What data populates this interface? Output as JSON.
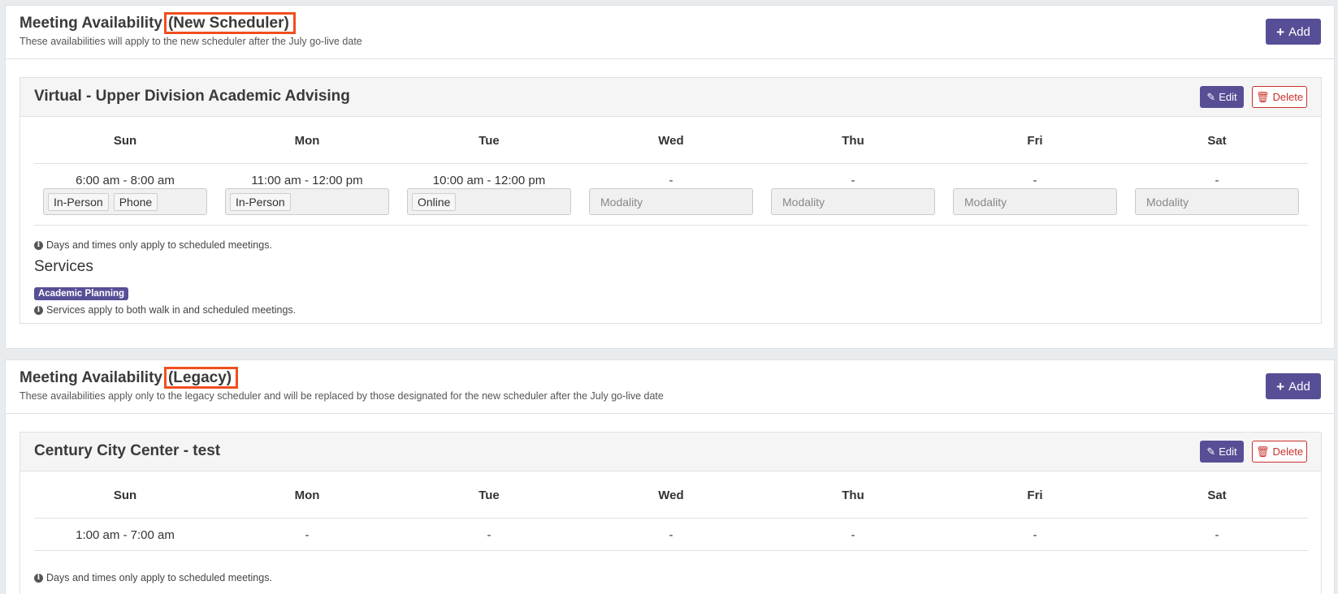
{
  "panels": [
    {
      "title_prefix": "Meeting Availability",
      "title_highlight": "(New Scheduler)",
      "subtitle": "These availabilities will apply to the new scheduler after the July go-live date",
      "add_label": "Add",
      "card": {
        "title": "Virtual - Upper Division Academic Advising",
        "edit_label": "Edit",
        "delete_label": "Delete",
        "days": [
          "Sun",
          "Mon",
          "Tue",
          "Wed",
          "Thu",
          "Fri",
          "Sat"
        ],
        "times": [
          "6:00 am - 8:00 am",
          "11:00 am - 12:00 pm",
          "10:00 am - 12:00 pm",
          "-",
          "-",
          "-",
          "-"
        ],
        "modalities": [
          [
            "In-Person",
            "Phone"
          ],
          [
            "In-Person"
          ],
          [
            "Online"
          ],
          [],
          [],
          [],
          []
        ],
        "modality_placeholder": "Modality",
        "info_days": "Days and times only apply to scheduled meetings.",
        "services_heading": "Services",
        "service_badge": "Academic Planning",
        "info_services": "Services apply to both walk in and scheduled meetings."
      }
    },
    {
      "title_prefix": "Meeting Availability",
      "title_highlight": "(Legacy)",
      "subtitle": "These availabilities apply only to the legacy scheduler and will be replaced by those designated for the new scheduler after the July go-live date",
      "add_label": "Add",
      "card": {
        "title": "Century City Center - test",
        "edit_label": "Edit",
        "delete_label": "Delete",
        "days": [
          "Sun",
          "Mon",
          "Tue",
          "Wed",
          "Thu",
          "Fri",
          "Sat"
        ],
        "times": [
          "1:00 am - 7:00 am",
          "-",
          "-",
          "-",
          "-",
          "-",
          "-"
        ],
        "info_days": "Days and times only apply to scheduled meetings."
      }
    }
  ],
  "icons": {
    "add": "plus-icon",
    "edit": "pencil-icon",
    "delete": "trash-icon",
    "info": "info-circle-icon"
  },
  "colors": {
    "primary": "#564f96",
    "danger": "#c9302c",
    "highlight": "#f04e1f"
  }
}
